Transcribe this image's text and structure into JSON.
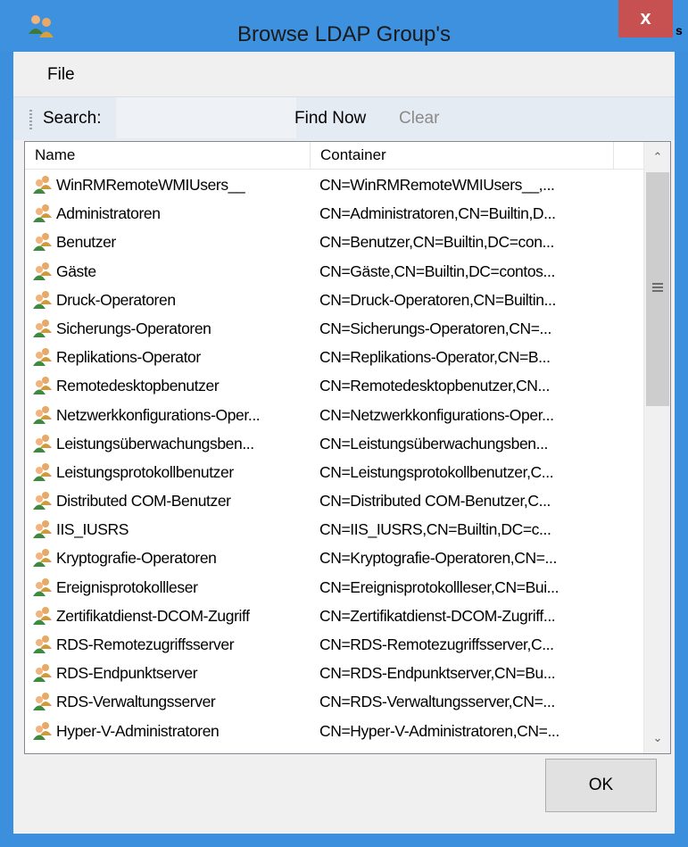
{
  "window": {
    "title": "Browse LDAP Group's",
    "close_label": "x",
    "side_fragment": "s"
  },
  "menu": {
    "file_label": "File"
  },
  "toolbar": {
    "search_label": "Search:",
    "search_value": "",
    "find_now_label": "Find Now",
    "clear_label": "Clear"
  },
  "list": {
    "columns": [
      "Name",
      "Container"
    ],
    "rows": [
      {
        "name": "WinRMRemoteWMIUsers__",
        "container": "CN=WinRMRemoteWMIUsers__,..."
      },
      {
        "name": "Administratoren",
        "container": "CN=Administratoren,CN=Builtin,D..."
      },
      {
        "name": "Benutzer",
        "container": "CN=Benutzer,CN=Builtin,DC=con..."
      },
      {
        "name": "Gäste",
        "container": "CN=Gäste,CN=Builtin,DC=contos..."
      },
      {
        "name": "Druck-Operatoren",
        "container": "CN=Druck-Operatoren,CN=Builtin..."
      },
      {
        "name": "Sicherungs-Operatoren",
        "container": "CN=Sicherungs-Operatoren,CN=..."
      },
      {
        "name": "Replikations-Operator",
        "container": "CN=Replikations-Operator,CN=B..."
      },
      {
        "name": "Remotedesktopbenutzer",
        "container": "CN=Remotedesktopbenutzer,CN..."
      },
      {
        "name": "Netzwerkkonfigurations-Oper...",
        "container": "CN=Netzwerkkonfigurations-Oper..."
      },
      {
        "name": "Leistungsüberwachungsben...",
        "container": "CN=Leistungsüberwachungsben..."
      },
      {
        "name": "Leistungsprotokollbenutzer",
        "container": "CN=Leistungsprotokollbenutzer,C..."
      },
      {
        "name": "Distributed COM-Benutzer",
        "container": "CN=Distributed COM-Benutzer,C..."
      },
      {
        "name": "IIS_IUSRS",
        "container": "CN=IIS_IUSRS,CN=Builtin,DC=c..."
      },
      {
        "name": "Kryptografie-Operatoren",
        "container": "CN=Kryptografie-Operatoren,CN=..."
      },
      {
        "name": "Ereignisprotokollleser",
        "container": "CN=Ereignisprotokollleser,CN=Bui..."
      },
      {
        "name": "Zertifikatdienst-DCOM-Zugriff",
        "container": "CN=Zertifikatdienst-DCOM-Zugriff..."
      },
      {
        "name": "RDS-Remotezugriffsserver",
        "container": "CN=RDS-Remotezugriffsserver,C..."
      },
      {
        "name": "RDS-Endpunktserver",
        "container": "CN=RDS-Endpunktserver,CN=Bu..."
      },
      {
        "name": "RDS-Verwaltungsserver",
        "container": "CN=RDS-Verwaltungsserver,CN=..."
      },
      {
        "name": "Hyper-V-Administratoren",
        "container": "CN=Hyper-V-Administratoren,CN=..."
      }
    ]
  },
  "footer": {
    "ok_label": "OK"
  },
  "icons": {
    "app": "users-app-icon",
    "group": "user-group-icon",
    "scroll_up": "chevron-up-icon",
    "scroll_down": "chevron-down-icon"
  },
  "colors": {
    "titlebar": "#3d91de",
    "close_button": "#c75050",
    "client_bg": "#f0f0f0",
    "toolbar_bg": "#e4ebf3"
  }
}
